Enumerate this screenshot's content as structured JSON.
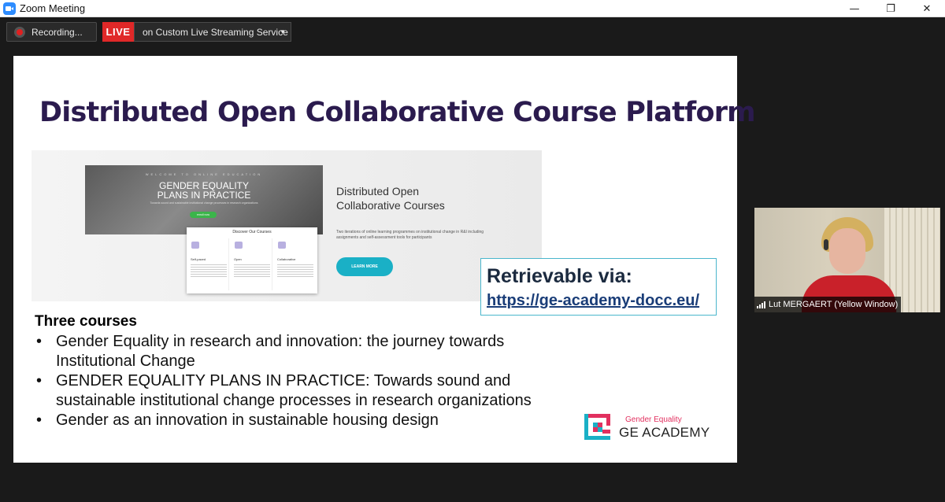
{
  "window": {
    "title": "Zoom Meeting",
    "controls": {
      "minimize": "—",
      "restore": "❐",
      "close": "✕"
    }
  },
  "meeting_bar": {
    "recording_label": "Recording...",
    "live_label": "LIVE",
    "stream_label": "on Custom Live Streaming Service",
    "stream_caret": "▾"
  },
  "slide": {
    "title": "Distributed Open Collaborative Course Platform",
    "screenshot": {
      "hero_kicker": "WELCOME TO ONLINE EDUCATION",
      "hero_title_line1": "GENDER EQUALITY",
      "hero_title_line2": "PLANS IN PRACTICE",
      "hero_sub": "Towards sound and sustainable institutional change processes in research organizations",
      "hero_button": "enroll now",
      "card_title": "Discover Our Courses",
      "card_columns": [
        "Self-paced",
        "Open",
        "Collaborative"
      ],
      "heading_line1": "Distributed Open",
      "heading_line2": "Collaborative Courses",
      "description": "Two iterations of online learning programmes on institutional change in R&I including assignments and self-assessment tools for participants",
      "learn_more": "LEARN MORE"
    },
    "retrievable": {
      "title": "Retrievable via:",
      "link": "https://ge-academy-docc.eu/"
    },
    "courses_heading": "Three courses",
    "courses": [
      "Gender Equality in research and innovation: the journey towards Institutional Change",
      "GENDER EQUALITY PLANS IN PRACTICE: Towards sound and sustainable institutional change processes in research organizations",
      "Gender as an innovation in sustainable housing design"
    ],
    "logo": {
      "small": "Gender Equality",
      "big": "GE ACADEMY",
      "colors": {
        "pink": "#e2305f",
        "teal": "#1ab0c6"
      }
    }
  },
  "participant": {
    "name": "Lut MERGAERT (Yellow Window)"
  },
  "colors": {
    "live_red": "#e02828",
    "slide_title": "#2b1b4e",
    "accent_teal": "#4ab6cc"
  }
}
